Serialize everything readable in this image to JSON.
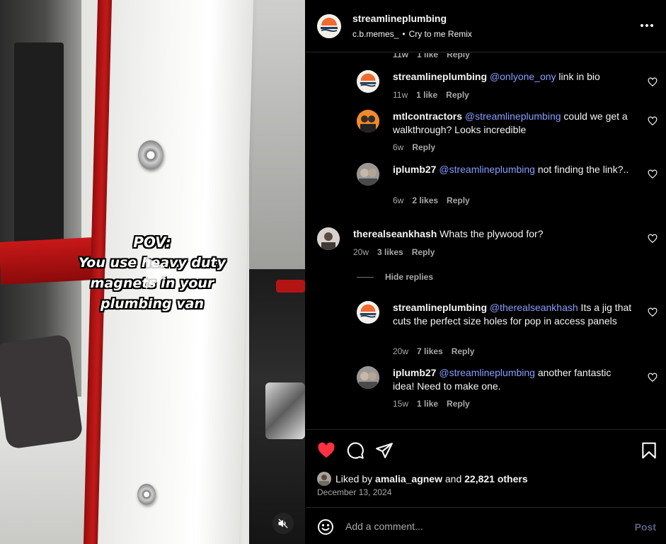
{
  "video": {
    "caption_lines": [
      "POV:",
      "You use heavy duty",
      "magnets in your",
      "plumbing van"
    ],
    "play_icon": "play-icon",
    "mute_icon": "speaker-muted-icon"
  },
  "header": {
    "username": "streamlineplumbing",
    "audio_author": "c.b.memes_",
    "audio_separator": "•",
    "audio_title": "Cry to me Remix",
    "more_icon": "more-horizontal-icon"
  },
  "comments": {
    "cut_meta": {
      "time": "11w",
      "likes": "1 like",
      "reply": "Reply"
    },
    "items": [
      {
        "user": "streamlineplumbing",
        "mention": "@onlyone_ony",
        "text": " link in bio",
        "time": "11w",
        "likes": "1 like",
        "reply": "Reply"
      },
      {
        "user": "mtlcontractors",
        "mention": "@streamlineplumbing",
        "text": " could we get a walkthrough? Looks incredible",
        "time": "6w",
        "likes": "",
        "reply": "Reply"
      },
      {
        "user": "iplumb27",
        "mention": "@streamlineplumbing",
        "text": " not finding the link?..",
        "time": "6w",
        "likes": "2 likes",
        "reply": "Reply"
      },
      {
        "user": "therealseankhash",
        "mention": "",
        "text": " Whats the plywood for?",
        "time": "20w",
        "likes": "3 likes",
        "reply": "Reply"
      },
      {
        "user": "streamlineplumbing",
        "mention": "@therealseankhash",
        "text": " Its a jig that cuts the perfect size holes for pop in access panels",
        "time": "20w",
        "likes": "7 likes",
        "reply": "Reply"
      },
      {
        "user": "iplumb27",
        "mention": "@streamlineplumbing",
        "text": " another fantastic idea! Need to make one.",
        "time": "15w",
        "likes": "1 like",
        "reply": "Reply"
      }
    ],
    "hide_replies": "Hide replies",
    "like_icon": "heart-outline-icon"
  },
  "actions": {
    "like_icon": "heart-filled-icon",
    "comment_icon": "comment-icon",
    "share_icon": "send-icon",
    "save_icon": "bookmark-icon",
    "like_color": "#ff3040",
    "liked_by_prefix": "Liked by ",
    "liked_by_user": "amalia_agnew",
    "liked_by_middle": " and ",
    "liked_by_count": "22,821 others",
    "date": "December 13, 2024"
  },
  "add_comment": {
    "emoji_icon": "emoji-smile-icon",
    "placeholder": "Add a comment...",
    "post_label": "Post"
  }
}
